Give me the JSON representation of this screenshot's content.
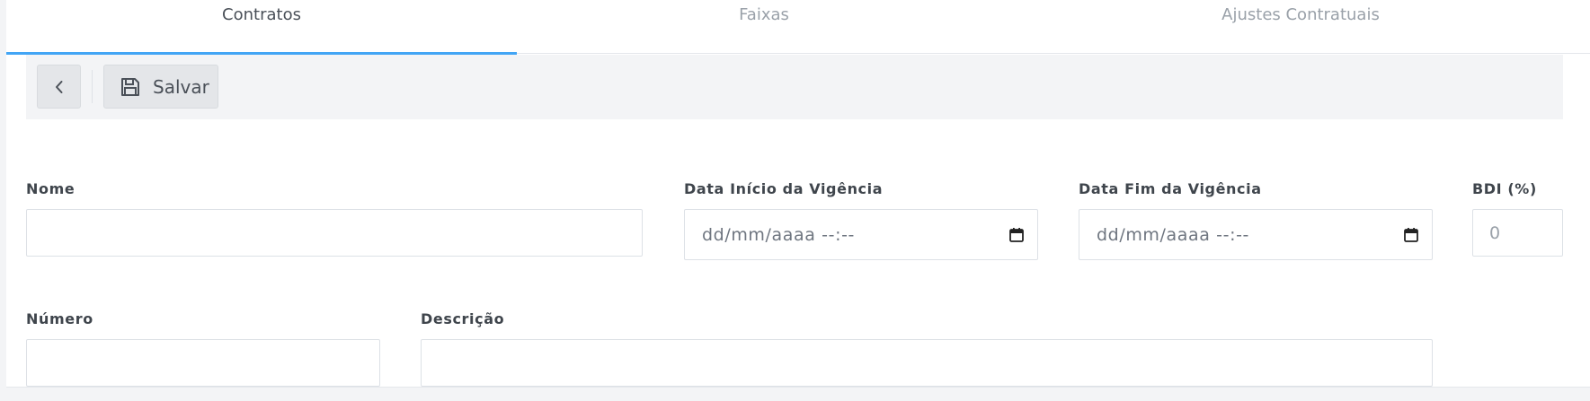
{
  "tabs": [
    {
      "label": "Contratos",
      "active": true
    },
    {
      "label": "Faixas",
      "active": false
    },
    {
      "label": "Ajustes Contratuais",
      "active": false
    }
  ],
  "toolbar": {
    "back_icon": "chevron-left-icon",
    "save_icon": "floppy-disk-icon",
    "save_label": "Salvar"
  },
  "form": {
    "nome": {
      "label": "Nome",
      "value": ""
    },
    "data_inicio": {
      "label": "Data Início da Vigência",
      "value": "dd/mm/aaaa --:--"
    },
    "data_fim": {
      "label": "Data Fim da Vigência",
      "value": "dd/mm/aaaa --:--"
    },
    "bdi": {
      "label": "BDI (%)",
      "value": "0"
    },
    "numero": {
      "label": "Número",
      "value": ""
    },
    "descricao": {
      "label": "Descrição",
      "value": ""
    }
  },
  "colors": {
    "accent": "#42a5f5",
    "toolbar_bg": "#f3f4f6",
    "button_bg": "#e4e6e9"
  }
}
